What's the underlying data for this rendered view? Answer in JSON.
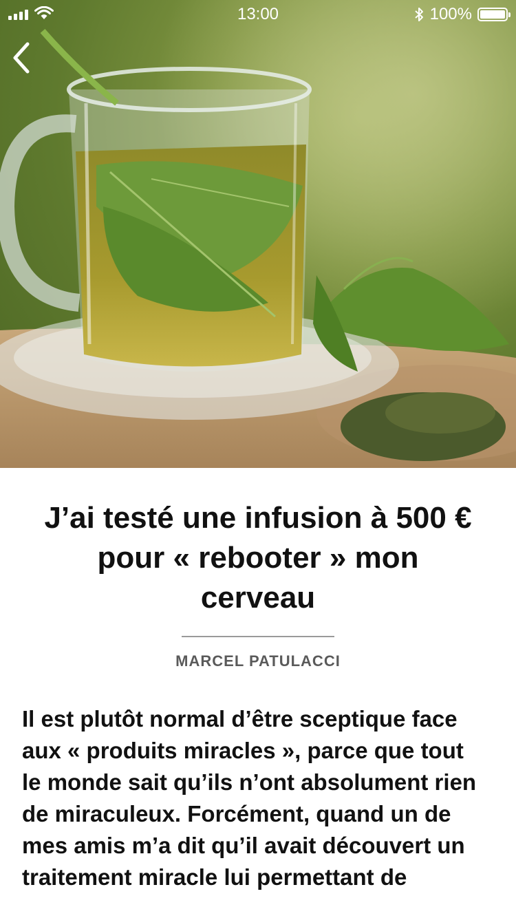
{
  "status_bar": {
    "time": "13:00",
    "battery_percent": "100%",
    "battery_level": 1.0,
    "signal_icon": "cellular-signal-icon",
    "wifi_icon": "wifi-icon",
    "bluetooth_icon": "bluetooth-icon",
    "battery_icon": "battery-icon"
  },
  "navigation": {
    "back_icon": "chevron-left-icon"
  },
  "hero": {
    "image": "herbal-tea-cup-with-nettle-leaves"
  },
  "article": {
    "title": "J’ai testé une infusion à 500 € pour « rebooter » mon cerveau",
    "author": "MARCEL PATULACCI",
    "body": "Il est plutôt normal d’être sceptique face aux « produits miracles », parce que tout le monde sait qu’ils n’ont absolument rien de miraculeux. Forcément, quand un de mes amis m’a dit qu’il avait découvert un traitement miracle lui permettant de"
  }
}
